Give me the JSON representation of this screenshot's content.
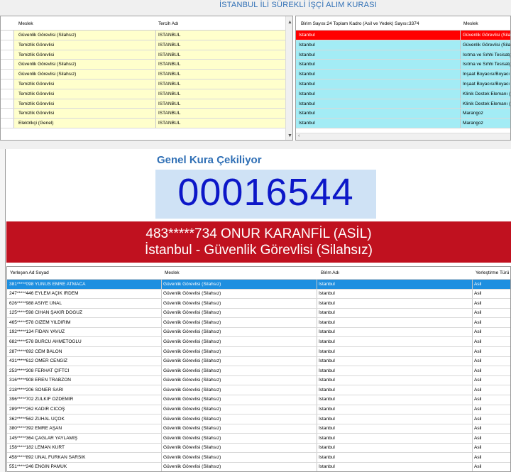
{
  "app_title": "İSTANBUL İLİ SÜREKLİ İŞÇİ ALIM KURASI",
  "top_left_grid": {
    "columns": [
      "Meslek",
      "Tercih Adı"
    ],
    "rows": [
      [
        "Güvenlik Görevlisi (Silahsız)",
        "İSTANBUL"
      ],
      [
        "Temizlik Görevlisi",
        "İSTANBUL"
      ],
      [
        "Temizlik Görevlisi",
        "İSTANBUL"
      ],
      [
        "Güvenlik Görevlisi (Silahsız)",
        "İSTANBUL"
      ],
      [
        "Güvenlik Görevlisi (Silahsız)",
        "İSTANBUL"
      ],
      [
        "Temizlik Görevlisi",
        "İSTANBUL"
      ],
      [
        "Temizlik Görevlisi",
        "İSTANBUL"
      ],
      [
        "Temizlik Görevlisi",
        "İSTANBUL"
      ],
      [
        "Temizlik Görevlisi",
        "İSTANBUL"
      ],
      [
        "Elektrikçi (Genel)",
        "İSTANBUL"
      ]
    ]
  },
  "top_right_grid": {
    "columns": [
      "Birim Sayısı:24 Toplam Kadro (Asil ve Yedek) Sayısı:3374",
      "Meslek"
    ],
    "rows": [
      [
        "İstanbul",
        "Güvenlik Görevlisi (Silah"
      ],
      [
        "İstanbul",
        "Güvenlik Görevlisi (Silah"
      ],
      [
        "İstanbul",
        "Isıtma ve Sıhhi Tesisatçı"
      ],
      [
        "İstanbul",
        "Isıtma ve Sıhhi Tesisatçı"
      ],
      [
        "İstanbul",
        "İnşaat Boyacısı/Boyacı"
      ],
      [
        "İstanbul",
        "İnşaat Boyacısı/Boyacı"
      ],
      [
        "İstanbul",
        "Klinik Destek Elemanı (K"
      ],
      [
        "İstanbul",
        "Klinik Destek Elemanı (K"
      ],
      [
        "İstanbul",
        "Marangoz"
      ],
      [
        "İstanbul",
        "Marangoz"
      ]
    ],
    "selected_index": 0
  },
  "draw": {
    "label": "Genel Kura Çekiliyor",
    "number": "00016544"
  },
  "winner": {
    "line1": "483*****734 ONUR KARANFİL (ASİL)",
    "line2": "İstanbul - Güvenlik Görevlisi (Silahsız)"
  },
  "results_grid": {
    "columns": [
      "Yerleşen Ad Soyad",
      "Meslek",
      "Birim Adı",
      "Yerleştirme Türü"
    ],
    "rows": [
      [
        "381*****098 YUNUS EMRE ATMACA",
        "Güvenlik Görevlisi (Silahsız)",
        "İstanbul",
        "Asil"
      ],
      [
        "247*****446 EYLEM AÇIK İRDEM",
        "Güvenlik Görevlisi (Silahsız)",
        "İstanbul",
        "Asil"
      ],
      [
        "626*****988 ASİYE ÜNAL",
        "Güvenlik Görevlisi (Silahsız)",
        "İstanbul",
        "Asil"
      ],
      [
        "125*****598 CİHAN ŞAKİR DOĞUZ",
        "Güvenlik Görevlisi (Silahsız)",
        "İstanbul",
        "Asil"
      ],
      [
        "465*****578 GİZEM YILDIRIM",
        "Güvenlik Görevlisi (Silahsız)",
        "İstanbul",
        "Asil"
      ],
      [
        "192*****134 FİDAN YAVUZ",
        "Güvenlik Görevlisi (Silahsız)",
        "İstanbul",
        "Asil"
      ],
      [
        "682*****578 BURCU AHMETOĞLU",
        "Güvenlik Görevlisi (Silahsız)",
        "İstanbul",
        "Asil"
      ],
      [
        "287*****692 CEM BALON",
        "Güvenlik Görevlisi (Silahsız)",
        "İstanbul",
        "Asil"
      ],
      [
        "431*****612 ÖMER CENGİZ",
        "Güvenlik Görevlisi (Silahsız)",
        "İstanbul",
        "Asil"
      ],
      [
        "253*****308 FERHAT ÇİFTCİ",
        "Güvenlik Görevlisi (Silahsız)",
        "İstanbul",
        "Asil"
      ],
      [
        "316*****908 EREN TRABZON",
        "Güvenlik Görevlisi (Silahsız)",
        "İstanbul",
        "Asil"
      ],
      [
        "218*****206 SONER SARI",
        "Güvenlik Görevlisi (Silahsız)",
        "İstanbul",
        "Asil"
      ],
      [
        "396*****702 ZÜLKİF ÖZDEMİR",
        "Güvenlik Görevlisi (Silahsız)",
        "İstanbul",
        "Asil"
      ],
      [
        "289*****262 KADİR CİCOŞ",
        "Güvenlik Görevlisi (Silahsız)",
        "İstanbul",
        "Asil"
      ],
      [
        "362*****562 ZÜHAL ÜÇOK",
        "Güvenlik Görevlisi (Silahsız)",
        "İstanbul",
        "Asil"
      ],
      [
        "380*****392 EMRE AŞAN",
        "Güvenlik Görevlisi (Silahsız)",
        "İstanbul",
        "Asil"
      ],
      [
        "145*****364 ÇAĞLAR YAYLAMIŞ",
        "Güvenlik Görevlisi (Silahsız)",
        "İstanbul",
        "Asil"
      ],
      [
        "158*****182 LEMAN KURT",
        "Güvenlik Görevlisi (Silahsız)",
        "İstanbul",
        "Asil"
      ],
      [
        "458*****892 ÜNAL FURKAN SARSIK",
        "Güvenlik Görevlisi (Silahsız)",
        "İstanbul",
        "Asil"
      ],
      [
        "551*****246 ENGİN PAMUK",
        "Güvenlik Görevlisi (Silahsız)",
        "İstanbul",
        "Asil"
      ]
    ],
    "selected_index": 0
  },
  "colors": {
    "title": "#2f6fb5",
    "assignment_row": "#ffffcc",
    "unit_row": "#a3ecf5",
    "unit_row_selected": "#ff0000",
    "counter_bg": "#cfe2f5",
    "counter_text": "#0c17c8",
    "winner_banner": "#c0111f",
    "results_row_selected": "#1e8fe0"
  }
}
